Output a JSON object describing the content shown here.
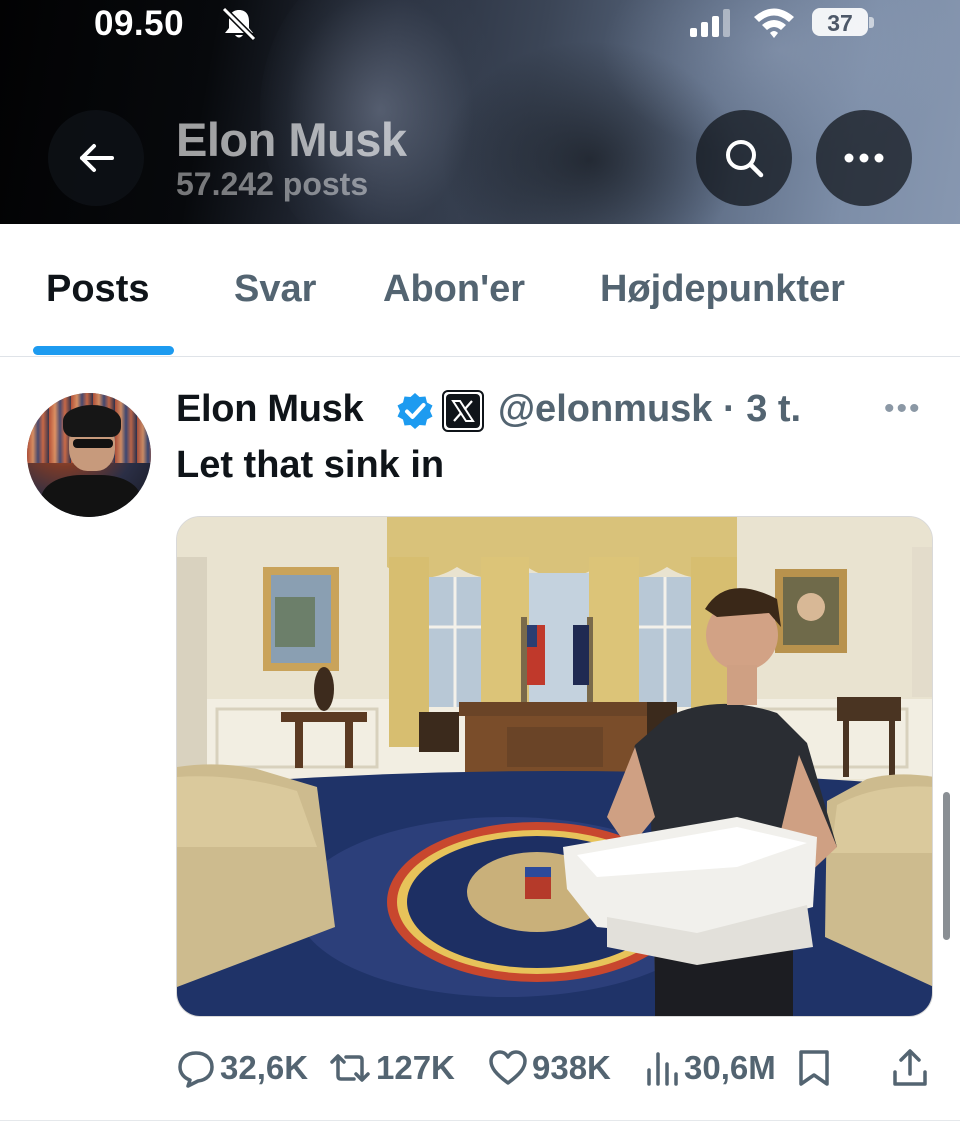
{
  "status_bar": {
    "time": "09.50",
    "battery": "37"
  },
  "header": {
    "name": "Elon Musk",
    "posts_count": "57.242 posts"
  },
  "tabs": [
    {
      "label": "Posts",
      "active": true
    },
    {
      "label": "Svar",
      "active": false
    },
    {
      "label": "Abon'er",
      "active": false
    },
    {
      "label": "Højdepunkter",
      "active": false
    }
  ],
  "post": {
    "author_name": "Elon Musk",
    "handle_time": "@elonmusk · 3 t.",
    "text": "Let that sink in",
    "actions": {
      "replies": "32,6K",
      "reposts": "127K",
      "likes": "938K",
      "views": "30,6M"
    }
  },
  "colors": {
    "accent": "#1d9bf0",
    "text_primary": "#0f1419",
    "text_secondary": "#536471",
    "verified": "#1d9bf0"
  },
  "icons": {
    "back": "arrow-left-icon",
    "search": "search-icon",
    "more": "more-horizontal-icon",
    "bell_off": "bell-slash-icon",
    "verified": "verified-badge-icon",
    "reply": "reply-icon",
    "repost": "repost-icon",
    "like": "heart-icon",
    "views": "views-icon",
    "bookmark": "bookmark-icon",
    "share": "share-icon"
  }
}
